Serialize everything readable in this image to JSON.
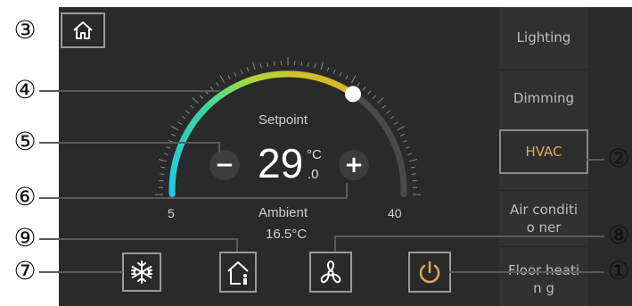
{
  "thermostat": {
    "setpoint_label": "Setpoint",
    "setpoint_value": "29",
    "setpoint_unit": "°C",
    "setpoint_decimal": ".0",
    "scale_min": "5",
    "scale_max": "40",
    "ambient_label": "Ambient",
    "ambient_value": "16.5°C",
    "minus_label": "−",
    "plus_label": "+"
  },
  "sidebar": {
    "items": [
      {
        "label": "Lighting"
      },
      {
        "label": "Dimming"
      },
      {
        "label": "HVAC",
        "active": true
      },
      {
        "label": "Air conditio ner"
      },
      {
        "label": "Floor heatin g"
      }
    ]
  },
  "callouts": [
    "①",
    "②",
    "③",
    "④",
    "⑤",
    "⑥",
    "⑦",
    "⑧",
    "⑨"
  ],
  "colors": {
    "accent": "#e7a657",
    "background": "#2a2a2a",
    "arc_start": "#1ec8e6",
    "arc_mid": "#a8dc3c",
    "arc_end": "#f2a81e"
  },
  "icons": {
    "home": "home-icon",
    "snowflake": "snowflake-icon",
    "home_person": "home-person-icon",
    "fan": "fan-icon",
    "power": "power-icon"
  }
}
